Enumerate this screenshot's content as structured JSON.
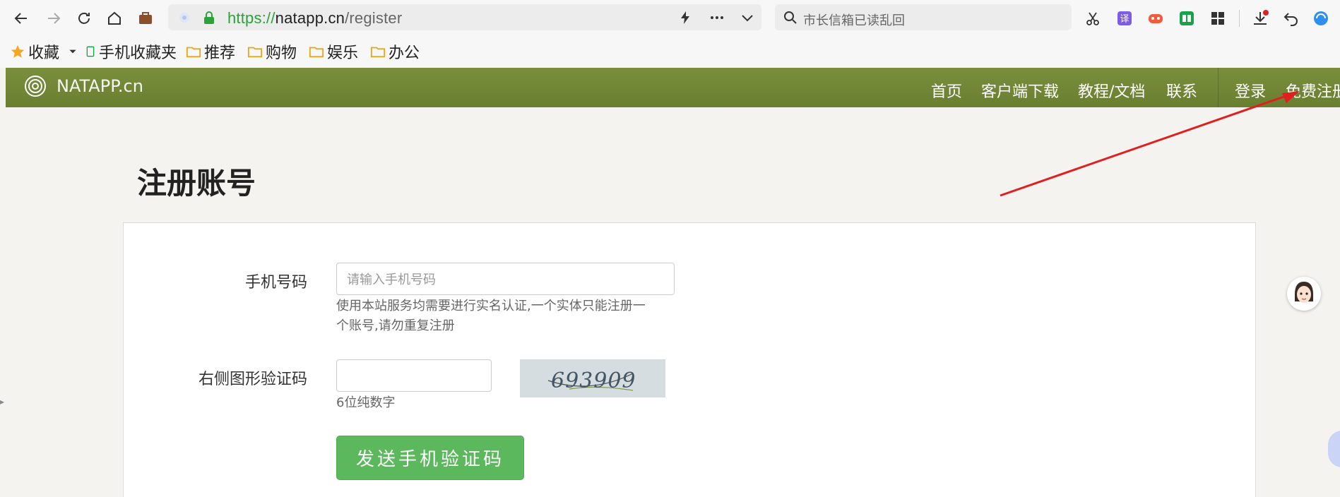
{
  "browser": {
    "url": {
      "scheme": "https://",
      "host": "natapp.cn",
      "path": "/register"
    },
    "search_placeholder": "市长信箱已读乱回"
  },
  "bookmarks": [
    "收藏",
    "手机收藏夹",
    "推荐",
    "购物",
    "娱乐",
    "办公"
  ],
  "nav": {
    "brand": "NATAPP.cn",
    "links": [
      "首页",
      "客户端下载",
      "教程/文档",
      "联系",
      "登录",
      "免费注册"
    ]
  },
  "page": {
    "title": "注册账号",
    "phone": {
      "label": "手机号码",
      "placeholder": "请输入手机号码",
      "help_line1": "使用本站服务均需要进行实名认证,一个实体只能注册一",
      "help_line2": "个账号,请勿重复注册"
    },
    "captcha": {
      "label": "右侧图形验证码",
      "value": "",
      "help": "6位纯数字",
      "image_text": "693909"
    },
    "send_button": "发送手机验证码"
  },
  "colors": {
    "navbar": "#6f8434",
    "send_button": "#5cb85c",
    "arrow": "#e02020"
  }
}
